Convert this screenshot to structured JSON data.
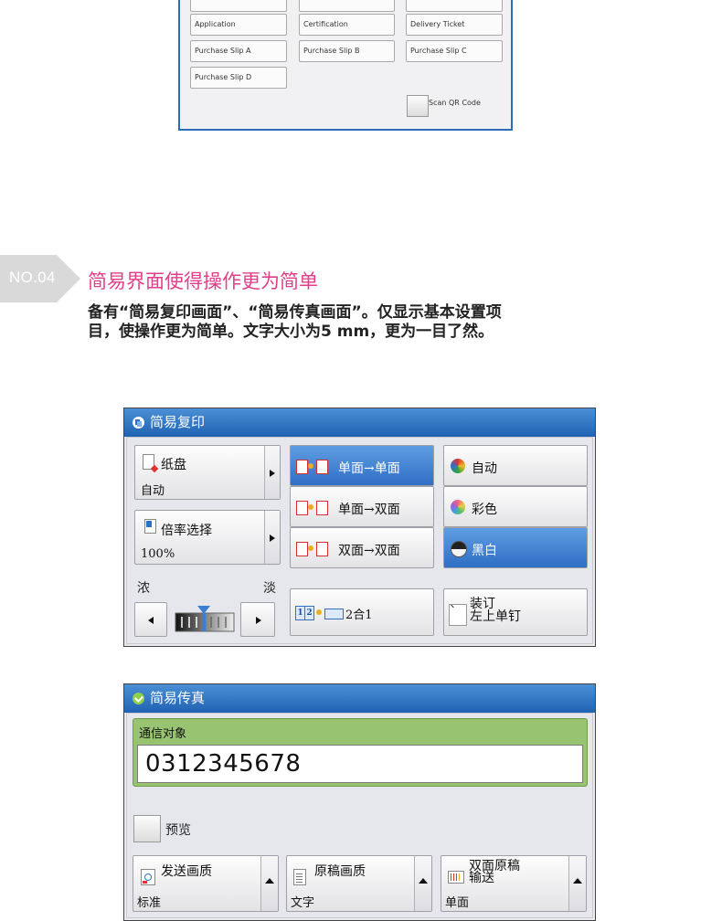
{
  "top_panel": {
    "buttons": [
      "Application",
      "Certification",
      "Delivery Ticket",
      "Purchase Slip A",
      "Purchase Slip B",
      "Purchase Slip C",
      "Purchase Slip D"
    ],
    "scan_qr": "Scan QR Code"
  },
  "section": {
    "badge": "NO.04",
    "heading": "简易界面使得操作更为简单",
    "desc_line1": "备有“简易复印画面”、“简易传真画面”。仅显示基本设置项",
    "desc_line2": "目，使操作更为简单。文字大小为5 mm，更为一目了然。"
  },
  "copy_panel": {
    "title": "简易复印",
    "paper_label": "纸盘",
    "paper_value": "自动",
    "ratio_label": "倍率选择",
    "ratio_value": "100%",
    "density_dark": "浓",
    "density_light": "淡",
    "duplex_options": [
      "单面→单面",
      "单面→双面",
      "双面→双面"
    ],
    "duplex_selected_index": 0,
    "color_options": [
      "自动",
      "彩色",
      "黑白"
    ],
    "color_selected_index": 2,
    "nup_label": "2合1",
    "staple_label": "装订",
    "staple_value": "左上单钉"
  },
  "fax_panel": {
    "title": "简易传真",
    "dest_label": "通信对象",
    "dest_value": "0312345678",
    "preview_label": "预览",
    "resolution_label": "发送画质",
    "resolution_value": "标准",
    "original_type_label": "原稿画质",
    "original_type_value": "文字",
    "duplex_label_1": "双面原稿",
    "duplex_label_2": "输送",
    "duplex_value": "单面"
  },
  "colors": {
    "title_bar": "#2f72c0",
    "selected": "#3f80d2",
    "accent_heading": "#e0408a",
    "badge": "#d9d9d9",
    "dest_green": "#98c472"
  }
}
